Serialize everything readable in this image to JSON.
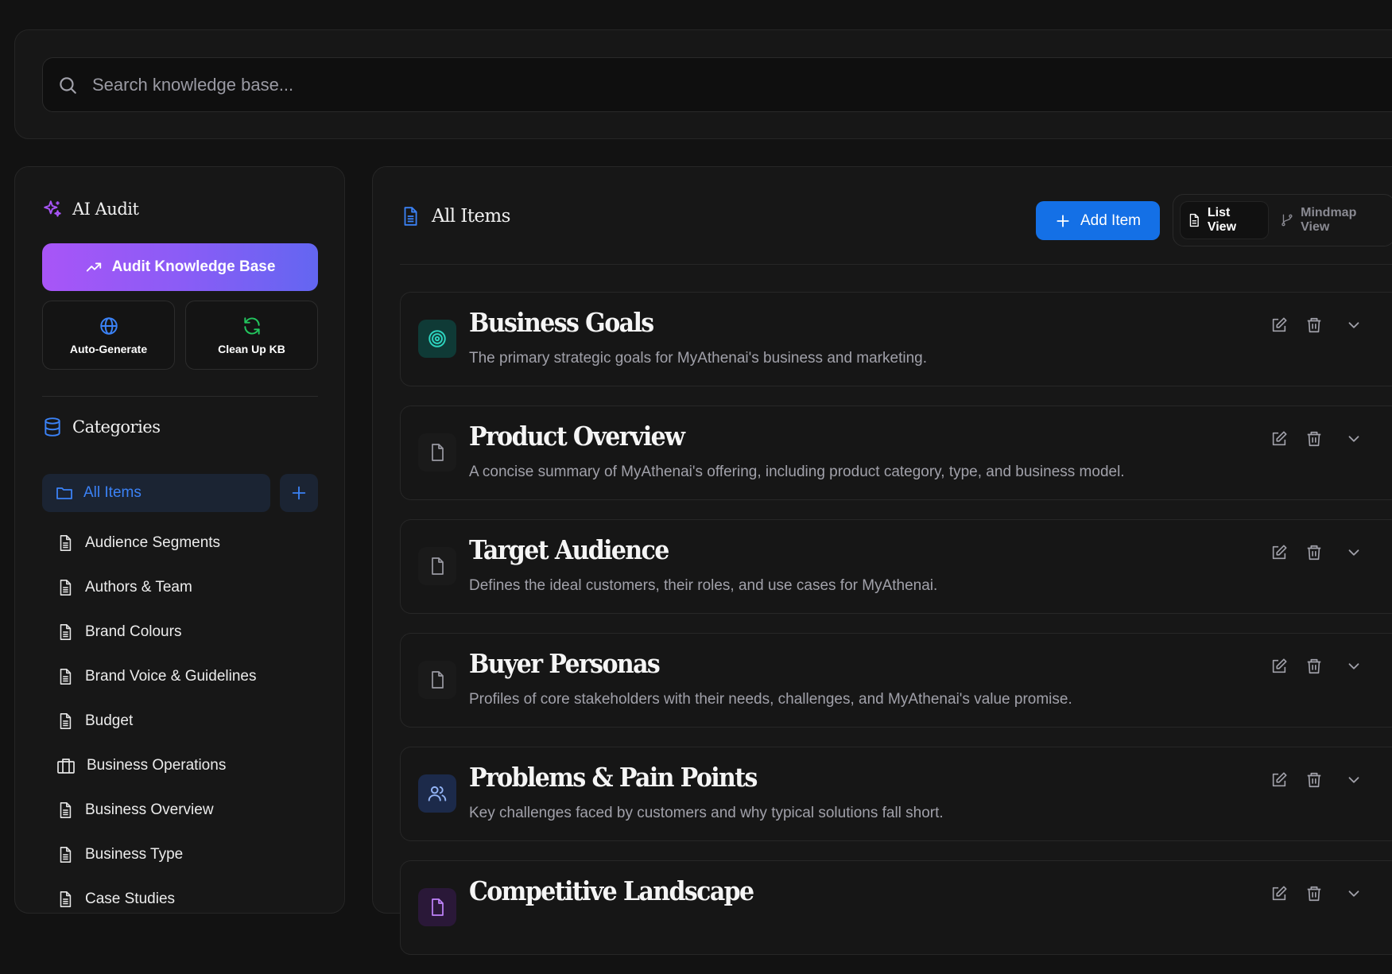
{
  "search": {
    "placeholder": "Search knowledge base..."
  },
  "sidebar": {
    "ai_audit_title": "AI Audit",
    "audit_button": "Audit Knowledge Base",
    "tools": [
      {
        "label": "Auto-Generate",
        "icon": "globe-icon"
      },
      {
        "label": "Clean Up KB",
        "icon": "refresh-icon"
      }
    ],
    "categories_title": "Categories",
    "all_items_label": "All Items",
    "categories": [
      {
        "label": "Audience Segments",
        "icon": "document-icon"
      },
      {
        "label": "Authors & Team",
        "icon": "document-icon"
      },
      {
        "label": "Brand Colours",
        "icon": "document-icon"
      },
      {
        "label": "Brand Voice & Guidelines",
        "icon": "document-icon"
      },
      {
        "label": "Budget",
        "icon": "document-icon"
      },
      {
        "label": "Business Operations",
        "icon": "briefcase-icon"
      },
      {
        "label": "Business Overview",
        "icon": "document-icon"
      },
      {
        "label": "Business Type",
        "icon": "document-icon"
      },
      {
        "label": "Case Studies",
        "icon": "document-icon"
      }
    ]
  },
  "main": {
    "title": "All Items",
    "add_button": "Add Item",
    "views": {
      "list": "List View",
      "mindmap": "Mindmap View",
      "active": "list"
    },
    "items": [
      {
        "title": "Business Goals",
        "description": "The primary strategic goals for MyAthenai's business and marketing.",
        "icon": "target-icon",
        "icon_bg": "#0f3a36",
        "icon_color": "#2dd4bf"
      },
      {
        "title": "Product Overview",
        "description": "A concise summary of MyAthenai's offering, including product category, type, and business model.",
        "icon": "file-icon",
        "icon_bg": "#1a1a1a",
        "icon_color": "#9a9aa3"
      },
      {
        "title": "Target Audience",
        "description": "Defines the ideal customers, their roles, and use cases for MyAthenai.",
        "icon": "file-icon",
        "icon_bg": "#1a1a1a",
        "icon_color": "#9a9aa3"
      },
      {
        "title": "Buyer Personas",
        "description": "Profiles of core stakeholders with their needs, challenges, and MyAthenai's value promise.",
        "icon": "file-icon",
        "icon_bg": "#1a1a1a",
        "icon_color": "#9a9aa3"
      },
      {
        "title": "Problems & Pain Points",
        "description": "Key challenges faced by customers and why typical solutions fall short.",
        "icon": "users-icon",
        "icon_bg": "#1c2a4a",
        "icon_color": "#93b4f5"
      },
      {
        "title": "Competitive Landscape",
        "description": "",
        "icon": "file-icon",
        "icon_bg": "#2a1838",
        "icon_color": "#c084fc"
      }
    ]
  },
  "colors": {
    "accent_blue": "#1470e6",
    "audit_gradient_start": "#a855f7",
    "audit_gradient_end": "#6366f1",
    "background": "#121212"
  }
}
